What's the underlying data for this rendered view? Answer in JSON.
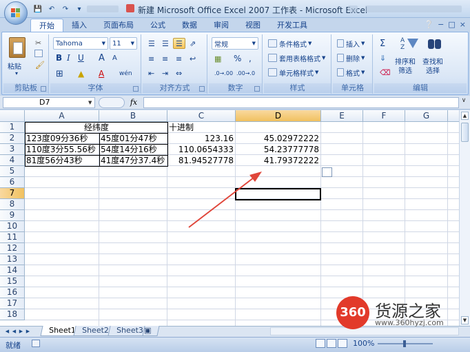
{
  "window": {
    "title": "新建 Microsoft Office Excel 2007 工作表 - Microsoft Excel"
  },
  "ribbon": {
    "tabs": [
      "开始",
      "插入",
      "页面布局",
      "公式",
      "数据",
      "审阅",
      "视图",
      "开发工具"
    ],
    "active_tab": "开始",
    "clipboard": {
      "paste_label": "粘贴",
      "group_label": "剪贴板"
    },
    "font": {
      "font_name": "Tahoma",
      "font_size": "11",
      "group_label": "字体",
      "bold": "B",
      "italic": "I",
      "underline": "U",
      "grow": "A",
      "shrink": "A",
      "pinyin": "wén"
    },
    "alignment": {
      "group_label": "对齐方式"
    },
    "number": {
      "format": "常规",
      "percent": "%",
      "comma": ",",
      "group_label": "数字"
    },
    "styles": {
      "conditional": "条件格式",
      "table": "套用表格格式",
      "cell_styles": "单元格样式",
      "group_label": "样式"
    },
    "cells": {
      "insert": "插入",
      "delete": "删除",
      "format": "格式",
      "group_label": "单元格"
    },
    "editing": {
      "sum": "Σ",
      "sort": "排序和\n筛选",
      "find": "查找和\n选择",
      "group_label": "编辑"
    }
  },
  "formula_bar": {
    "name_box": "D7",
    "fx": "fx",
    "formula": ""
  },
  "grid": {
    "columns": [
      "A",
      "B",
      "C",
      "D",
      "E",
      "F",
      "G"
    ],
    "selected_column": "D",
    "selected_row": "7",
    "rows": [
      "1",
      "2",
      "3",
      "4",
      "5",
      "6",
      "7",
      "8",
      "9",
      "10",
      "11",
      "12",
      "13",
      "14",
      "15",
      "16",
      "17",
      "18"
    ],
    "cells": {
      "A1": "经纬度",
      "C1": "十进制",
      "A2": "123度09分36秒",
      "B2": "45度01分47秒",
      "C2": "123.16",
      "D2": "45.02972222",
      "A3": "110度3分55.56秒",
      "B3": "54度14分16秒",
      "C3": "110.0654333",
      "D3": "54.23777778",
      "A4": "81度56分43秒",
      "B4": "41度47分37.4秒",
      "C4": "81.94527778",
      "D4": "41.79372222"
    }
  },
  "sheets": {
    "tabs": [
      "Sheet1",
      "Sheet2",
      "Sheet3"
    ],
    "active": "Sheet1"
  },
  "status": {
    "text": "就绪",
    "zoom": "100%"
  },
  "watermark": {
    "badge": "360",
    "name": "货源之家",
    "url": "www.360hyzj.com"
  },
  "colors": {
    "ribbon_bg": "#dbe7f6",
    "selected_header": "#f1c15f",
    "annotation_arrow": "#e0463a",
    "watermark_red": "#e23a2a"
  }
}
